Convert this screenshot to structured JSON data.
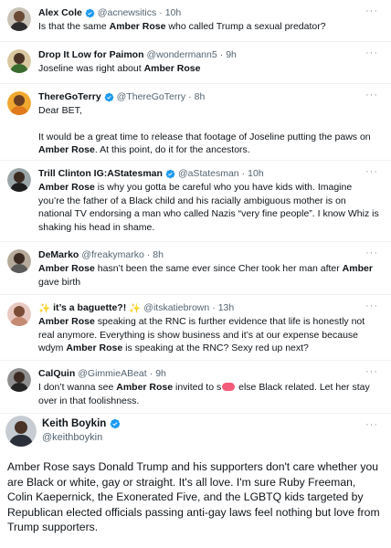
{
  "tweets": [
    {
      "name": "Alex Cole",
      "verified": true,
      "handle": "@acnewsitics",
      "dot": "·",
      "time": "10h",
      "more": "···",
      "avatar_colors": {
        "bg": "#c9c2b6",
        "head": "#6b4a35",
        "body": "#2d2d2d"
      },
      "text": [
        "Is that the same ",
        "Amber Rose",
        " who called Trump a sexual predator?"
      ]
    },
    {
      "name": "Drop It Low for Paimon",
      "verified": false,
      "handle": "@wondermann5",
      "dot": "·",
      "time": "9h",
      "more": "···",
      "avatar_colors": {
        "bg": "#d8c7a0",
        "head": "#4a3326",
        "body": "#3a6b2f"
      },
      "text": [
        "Joseline was right about ",
        "Amber Rose"
      ]
    },
    {
      "name": "ThereGoTerry",
      "verified": true,
      "handle": "@ThereGoTerry",
      "dot": "·",
      "time": "8h",
      "more": "···",
      "avatar_colors": {
        "bg": "#f0a830",
        "head": "#6a3f22",
        "body": "#e07a1c"
      },
      "text_p1": "Dear BET,",
      "text_p2": [
        "It would be a great time to release that footage of Joseline putting the paws on ",
        "Amber Rose",
        ". At this point, do it for the ancestors."
      ]
    },
    {
      "name": "Trill Clinton IG:AStatesman",
      "verified": true,
      "handle": "@aStatesman",
      "dot": "·",
      "time": "10h",
      "more": "···",
      "avatar_colors": {
        "bg": "#9aa5a8",
        "head": "#3b2a20",
        "body": "#1e1e1e"
      },
      "text": [
        "Amber Rose",
        " is why you gotta be careful who you have kids with. Imagine you’re the father of a Black child and his racially ambiguous mother is on national TV endorsing a man who called Nazis “very fine people”. I know Whiz is shaking his head in shame."
      ]
    },
    {
      "name": "DeMarko",
      "verified": false,
      "handle": "@freakymarko",
      "dot": "·",
      "time": "8h",
      "more": "···",
      "avatar_colors": {
        "bg": "#b5a999",
        "head": "#3a2a22",
        "body": "#5a5a5a"
      },
      "text": [
        "Amber Rose",
        " hasn’t been the same ever since Cher took her man after ",
        "Amber",
        " gave birth"
      ]
    },
    {
      "name": "it’s a baguette?!",
      "sparkle": "✨",
      "verified": false,
      "handle": "@itskatiebrown",
      "dot": "·",
      "time": "13h",
      "more": "···",
      "avatar_colors": {
        "bg": "#e8c9c1",
        "head": "#7a4b35",
        "body": "#c58a72"
      },
      "text": [
        "Amber Rose",
        " speaking at the RNC is further evidence that life is honestly not real anymore. Everything is show business and it’s at our expense because wdym ",
        "Amber Rose",
        " is speaking at the RNC? Sexy red up next?"
      ]
    },
    {
      "name": "CalQuin",
      "verified": false,
      "handle": "@GimmieABeat",
      "dot": "·",
      "time": "9h",
      "more": "···",
      "avatar_colors": {
        "bg": "#8f8f8f",
        "head": "#3a2a22",
        "body": "#242424"
      },
      "text_pre": "I don’t wanna see ",
      "text_bold": "Amber Rose",
      "text_mid": " invited to s",
      "text_post": " else Black related. Let her stay over in that foolishness."
    }
  ],
  "final": {
    "name": "Keith Boykin",
    "verified": true,
    "handle": "@keithboykin",
    "more": "···",
    "avatar_colors": {
      "bg": "#c6ccd2",
      "head": "#4a3326",
      "body": "#2a2f3a"
    },
    "text": "Amber Rose says Donald Trump and his supporters don't care whether you are Black or white, gay or straight. It's all love. I'm sure Ruby Freeman, Colin Kaepernick, the Exonerated Five, and the LGBTQ kids targeted by Republican elected officials passing anti-gay laws feel nothing but love from Trump supporters."
  },
  "colors": {
    "verified": "#1d9bf0",
    "muted": "#536471",
    "censor": "#f45b7a"
  }
}
